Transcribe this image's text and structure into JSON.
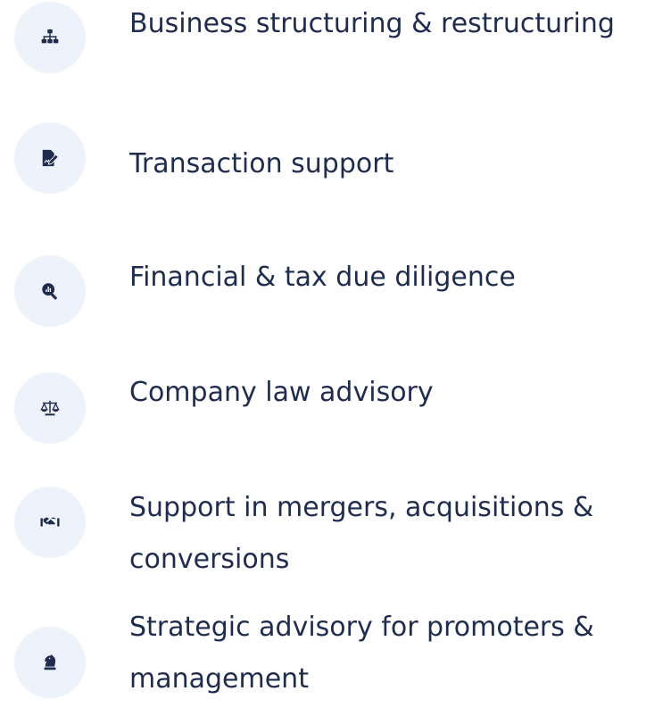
{
  "services": [
    {
      "label": "Business structuring & restructuring",
      "icon": "sitemap-icon"
    },
    {
      "label": "Transaction support",
      "icon": "signed-document-icon"
    },
    {
      "label": "Financial & tax due diligence",
      "icon": "magnifier-chart-icon"
    },
    {
      "label": "Company law advisory",
      "icon": "scales-icon"
    },
    {
      "label": "Support in mergers, acquisitions & conversions",
      "icon": "handshake-icon"
    },
    {
      "label": "Strategic advisory for promoters & management",
      "icon": "chess-knight-icon"
    }
  ],
  "colors": {
    "text": "#1f2c4d",
    "icon_background": "#eef2fb",
    "icon": "#1f2c4d"
  }
}
